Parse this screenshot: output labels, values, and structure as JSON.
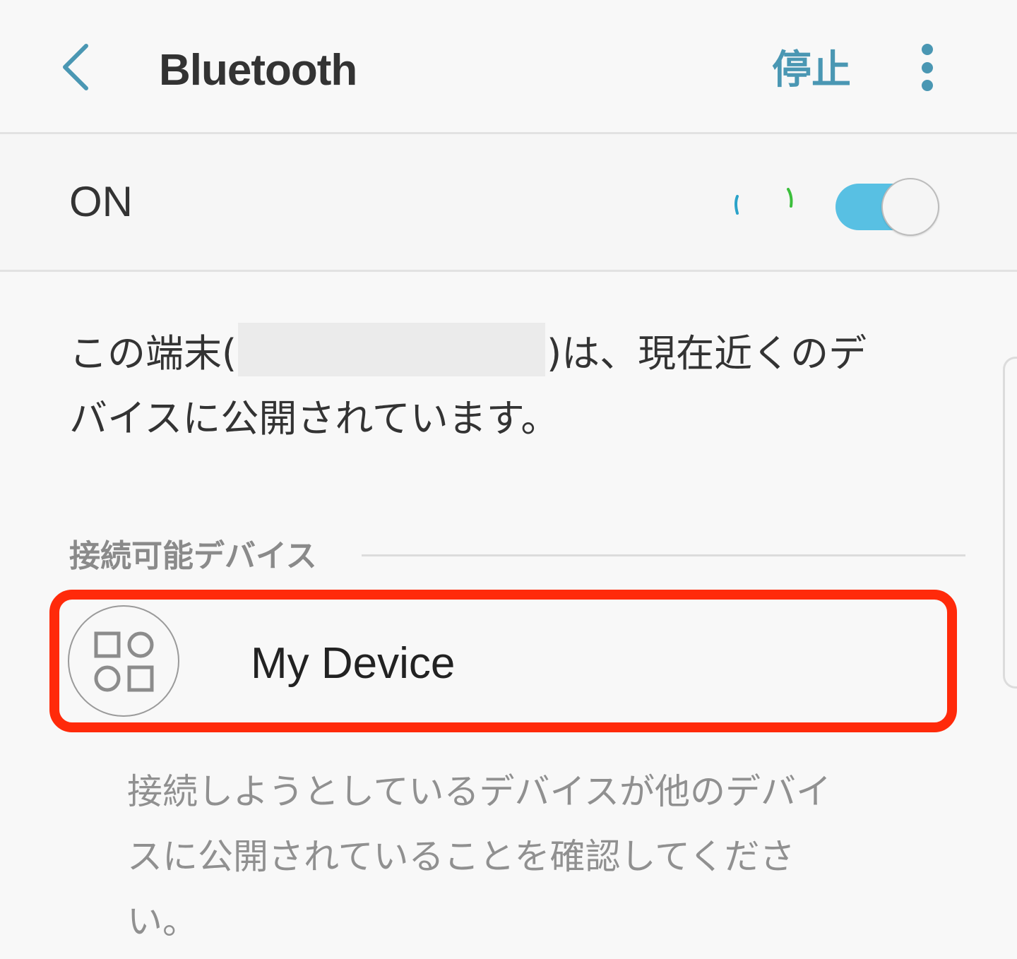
{
  "header": {
    "title": "Bluetooth",
    "stop_label": "停止"
  },
  "bluetooth": {
    "state_label": "ON",
    "enabled": true
  },
  "visibility": {
    "text_before": "この端末(",
    "text_after_line1": ")は、現在近くのデ",
    "text_line2": "バイスに公開されています。"
  },
  "available_devices": {
    "section_title": "接続可能デバイス",
    "items": [
      {
        "name": "My Device",
        "icon": "device-generic-icon"
      }
    ]
  },
  "hint": {
    "line1": "接続しようとしているデバイスが他のデバイ",
    "line2": "スに公開されていることを確認してくださ",
    "line3": "い。"
  },
  "colors": {
    "accent": "#4a97b3",
    "toggle_on": "#58c0e3",
    "highlight": "#ff2a0a",
    "background": "#f8f8f8"
  }
}
